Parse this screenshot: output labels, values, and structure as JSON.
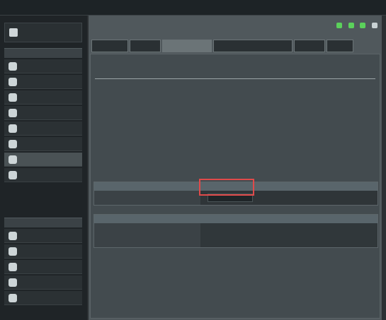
{
  "brand": {
    "logo_text": ""
  },
  "top_nav": {
    "tabs": [
      "",
      "",
      ""
    ],
    "language": ""
  },
  "info_bar": {
    "text": "",
    "link": ""
  },
  "sidebar": {
    "wizard_label": "",
    "general_header": "",
    "general_items": [
      {
        "label": "",
        "icon": "globe-icon"
      },
      {
        "label": "",
        "icon": "network-map-icon"
      },
      {
        "label": "",
        "icon": "guest-network-icon"
      },
      {
        "label": "",
        "icon": "traffic-manager-icon"
      },
      {
        "label": "",
        "icon": "parental-controls-icon"
      },
      {
        "label": "",
        "icon": "usb-application-icon"
      },
      {
        "label": "",
        "icon": "aicloud-icon"
      },
      {
        "label": "",
        "icon": "network-tools-icon"
      }
    ],
    "advanced_header": "",
    "advanced_items": [
      {
        "label": "",
        "icon": "wireless-icon"
      },
      {
        "label": "",
        "icon": "lan-icon"
      },
      {
        "label": "",
        "icon": "wan-icon"
      },
      {
        "label": "",
        "icon": "ipv6-icon"
      },
      {
        "label": "",
        "icon": "vpn-icon"
      }
    ]
  },
  "tabs": [
    {
      "label": "",
      "active": false
    },
    {
      "label": "",
      "active": false
    },
    {
      "label": "",
      "active": true
    },
    {
      "label": "",
      "active": false
    },
    {
      "label": "",
      "active": false
    },
    {
      "label": "",
      "active": false
    }
  ],
  "content": {
    "title": "",
    "subtitle": "",
    "bullets": [
      "",
      "",
      "",
      "",
      ""
    ],
    "table1": {
      "header": "",
      "label": "",
      "button": ""
    },
    "table2": {
      "header": "",
      "lines": [
        "",
        ""
      ]
    },
    "note": ""
  },
  "colors": {
    "background": "#2b3033",
    "sidebar": "#1f2427",
    "panel": "#434b4f",
    "tab_active": "#6b7477",
    "highlight": "#e04a4a",
    "note_text": "#e5e09a"
  }
}
